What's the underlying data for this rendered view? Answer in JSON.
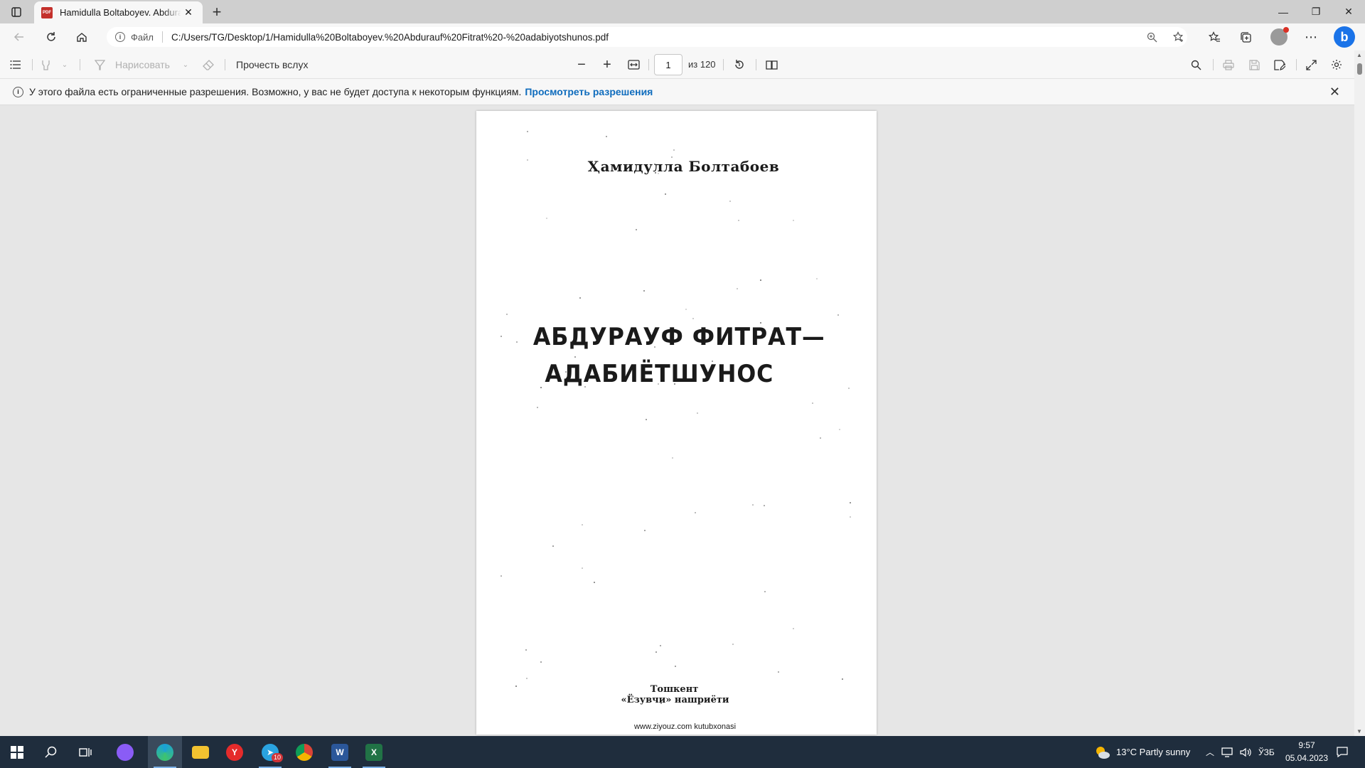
{
  "browser": {
    "tab": {
      "favicon_text": "PDF",
      "title": "Hamidulla Boltaboyev. Abdurauf Fitrat - adabiyotshunos.pdf",
      "close_glyph": "✕"
    },
    "new_tab_glyph": "+",
    "window_controls": {
      "minimize": "—",
      "restore": "❐",
      "close": "✕"
    },
    "address": {
      "scheme_label": "Файл",
      "url": "C:/Users/TG/Desktop/1/Hamidulla%20Boltaboyev.%20Abdurauf%20Fitrat%20-%20adabiyotshunos.pdf"
    },
    "bing_label": "b"
  },
  "pdf_toolbar": {
    "draw_label": "Нарисовать",
    "read_aloud_label": "Прочесть вслух",
    "zoom_out": "−",
    "zoom_in": "+",
    "current_page": "1",
    "page_total": "из 120"
  },
  "infobar": {
    "message": "У этого файла есть ограниченные разрешения. Возможно, у вас не будет доступа к некоторым функциям.",
    "link": "Просмотреть разрешения",
    "close_glyph": "✕"
  },
  "document": {
    "author": "Ҳамидулла Болтабоев",
    "title_line1": "АБДУРАУФ ФИТРАТ—",
    "title_line2": "АДАБИЁТШУНОС",
    "city": "Тошкент",
    "publisher": "«Ёзувчи» нашриёти",
    "website": "www.ziyouz.com kutubxonasi"
  },
  "taskbar": {
    "apps": [
      {
        "name": "start"
      },
      {
        "name": "search"
      },
      {
        "name": "task-view"
      },
      {
        "name": "alice",
        "color": "#8a5cf6"
      },
      {
        "name": "edge",
        "color": "#1aa0d8"
      },
      {
        "name": "file-explorer",
        "color": "#f2c230"
      },
      {
        "name": "yandex-browser",
        "color": "#e52b2b",
        "glyph": "Y"
      },
      {
        "name": "telegram",
        "color": "#2aa3e0",
        "badge": "10"
      },
      {
        "name": "chrome",
        "color": "#3ba55c"
      },
      {
        "name": "word",
        "color": "#2b579a",
        "glyph": "W"
      },
      {
        "name": "excel",
        "color": "#217346",
        "glyph": "X"
      }
    ],
    "weather": "13°C  Partly sunny",
    "language": "ЎЗБ",
    "time": "9:57",
    "date": "05.04.2023"
  }
}
